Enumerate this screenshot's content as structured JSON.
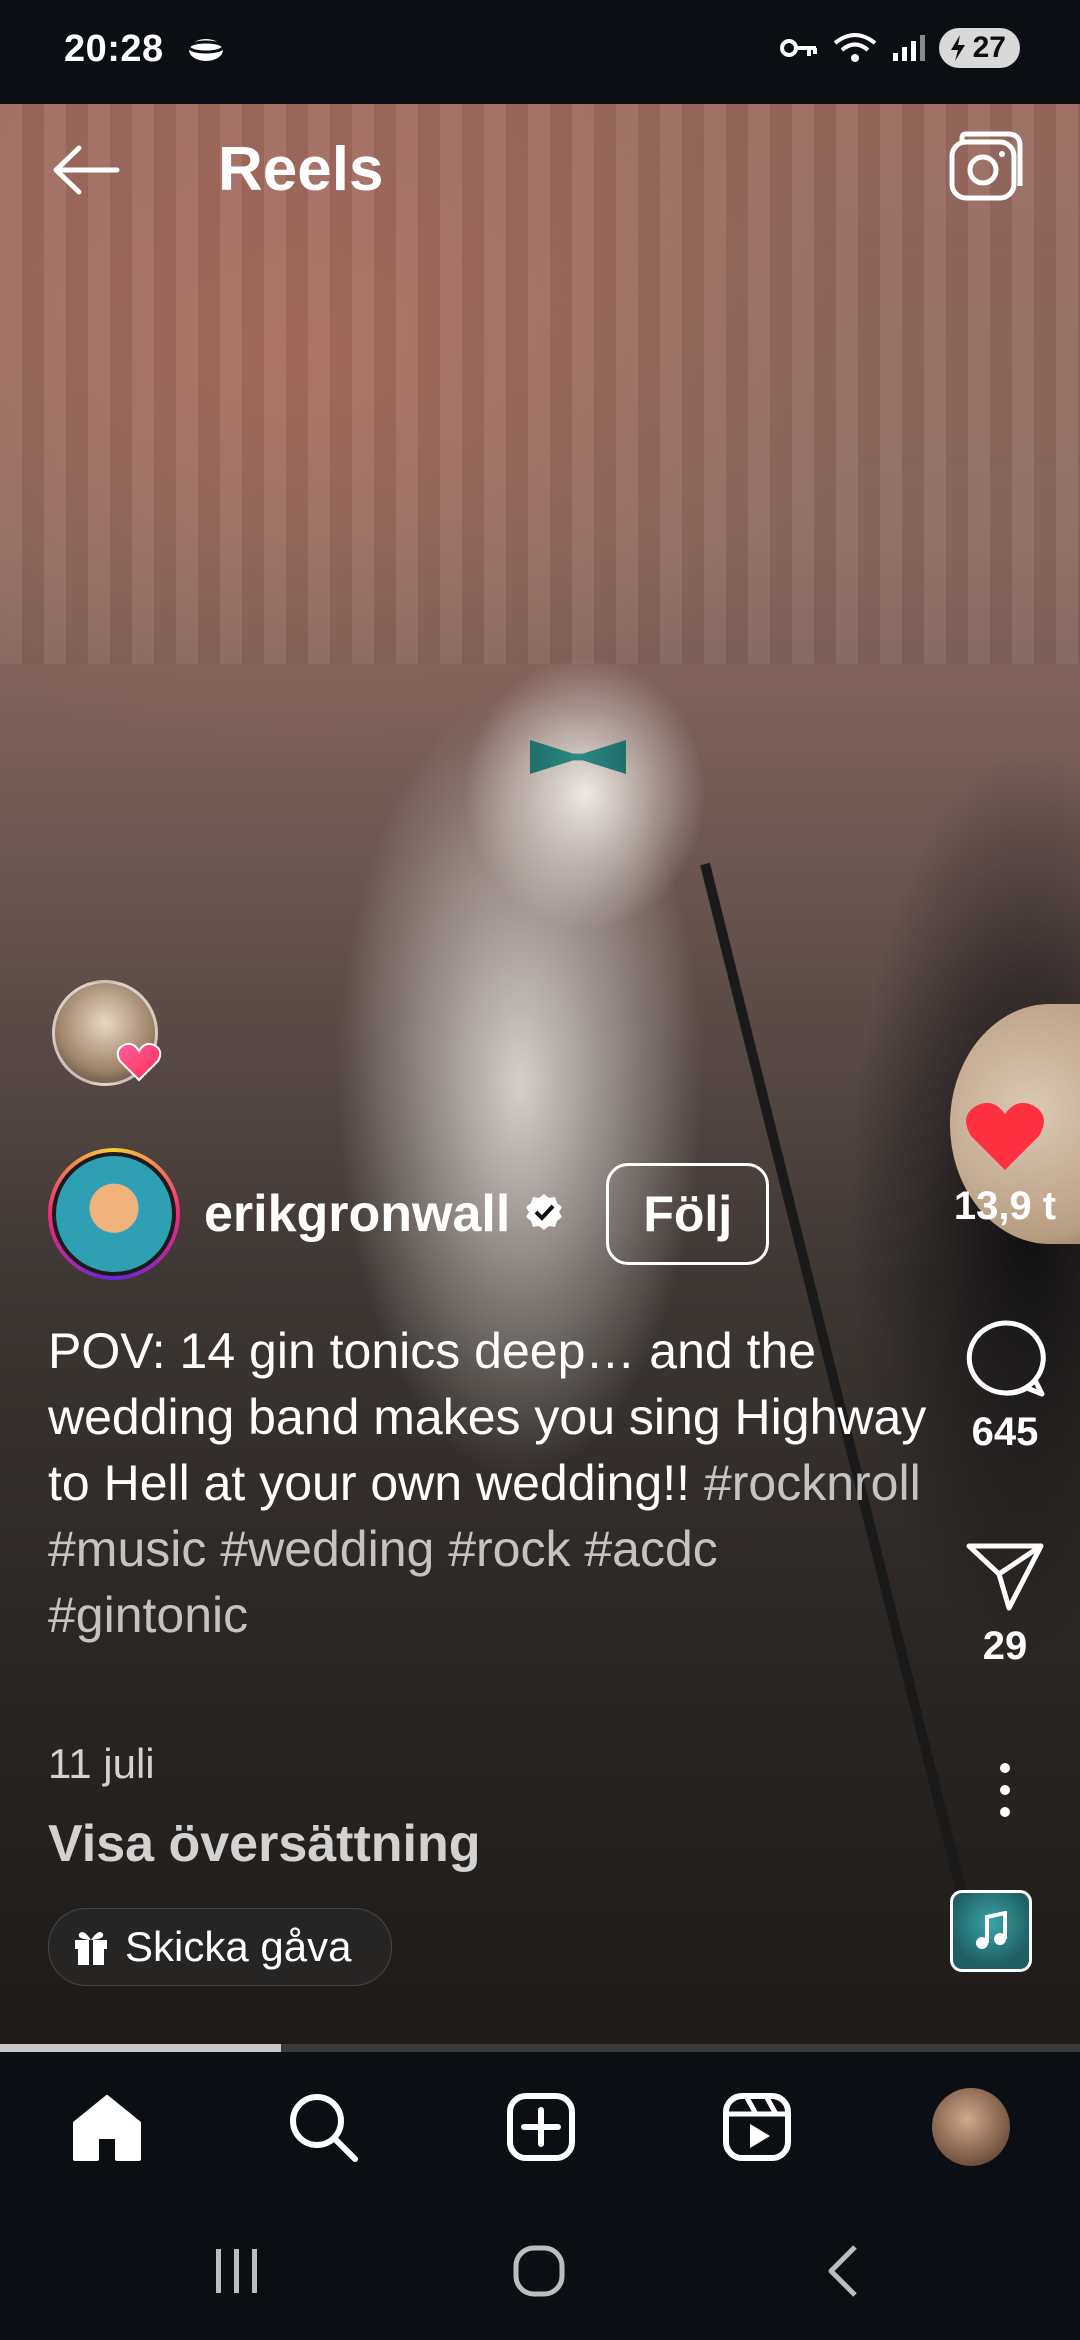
{
  "status_bar": {
    "time": "20:28",
    "battery": "27",
    "icons": [
      "cloud-icon",
      "key-icon",
      "wifi-icon",
      "signal-icon",
      "battery-icon"
    ]
  },
  "header": {
    "title": "Reels",
    "icons": [
      "back-arrow-icon",
      "camera-icon"
    ]
  },
  "reel": {
    "author": {
      "username": "erikgronwall",
      "verified": true,
      "follow_label": "Följ"
    },
    "caption_text": "POV: 14 gin tonics deep… and the wedding band makes you sing Highway to Hell at your own wedding!!",
    "hashtags": "#rocknroll #music #wedding #rock #acdc #gintonic",
    "date": "11 juli",
    "translate_label": "Visa översättning",
    "gift_label": "Skicka gåva",
    "progress_fraction": 0.26
  },
  "actions": {
    "likes": "13,9 t",
    "comments": "645",
    "shares": "29",
    "like_color": "#ff3040"
  },
  "bottom_nav": {
    "items": [
      "home-icon",
      "search-icon",
      "create-icon",
      "reels-icon",
      "profile-avatar"
    ]
  },
  "system_nav": {
    "items": [
      "recents-icon",
      "home-circle-icon",
      "back-chevron-icon"
    ]
  }
}
